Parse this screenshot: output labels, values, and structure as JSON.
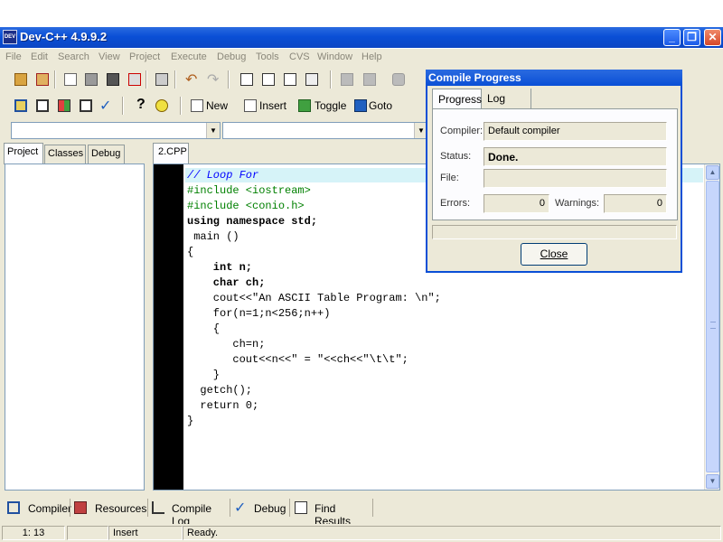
{
  "window": {
    "title": "Dev-C++ 4.9.9.2",
    "icon": "devcpp-icon"
  },
  "menu": [
    "File",
    "Edit",
    "Search",
    "View",
    "Project",
    "Execute",
    "Debug",
    "Tools",
    "CVS",
    "Window",
    "Help"
  ],
  "toolbar": {
    "new_label": "New",
    "insert_label": "Insert",
    "toggle_label": "Toggle",
    "goto_label": "Goto"
  },
  "left_panel": {
    "tabs": [
      "Project",
      "Classes",
      "Debug"
    ]
  },
  "editor": {
    "tab": "2.CPP",
    "lines": [
      "// Loop For",
      "#include <iostream>",
      "#include <conio.h>",
      "using namespace std;",
      " main ()",
      "{",
      "    int n;",
      "    char ch;",
      "    cout<<\"An ASCII Table Program: \\n\";",
      "    for(n=1;n<256;n++)",
      "    {",
      "       ch=n;",
      "       cout<<n<<\" = \"<<ch<<\"\\t\\t\";",
      "    }",
      "  getch();",
      "  return 0;",
      "}"
    ]
  },
  "bottom_tabs": [
    "Compiler",
    "Resources",
    "Compile Log",
    "Debug",
    "Find Results"
  ],
  "status": {
    "position": "1: 13",
    "mode": "Insert",
    "message": "Ready."
  },
  "dialog": {
    "title": "Compile Progress",
    "tabs": [
      "Progress",
      "Log"
    ],
    "compiler_label": "Compiler:",
    "compiler_value": "Default compiler",
    "status_label": "Status:",
    "status_value": "Done.",
    "file_label": "File:",
    "file_value": "",
    "errors_label": "Errors:",
    "errors_value": "0",
    "warnings_label": "Warnings:",
    "warnings_value": "0",
    "close_label": "Close"
  },
  "colors": {
    "title_bar": "#0a4fd6",
    "face": "#ece9d8",
    "highlight_line": "#d6f3f8",
    "comment": "#0000ff",
    "preprocessor": "#008000",
    "string": "#ff0000",
    "number": "#800080"
  }
}
